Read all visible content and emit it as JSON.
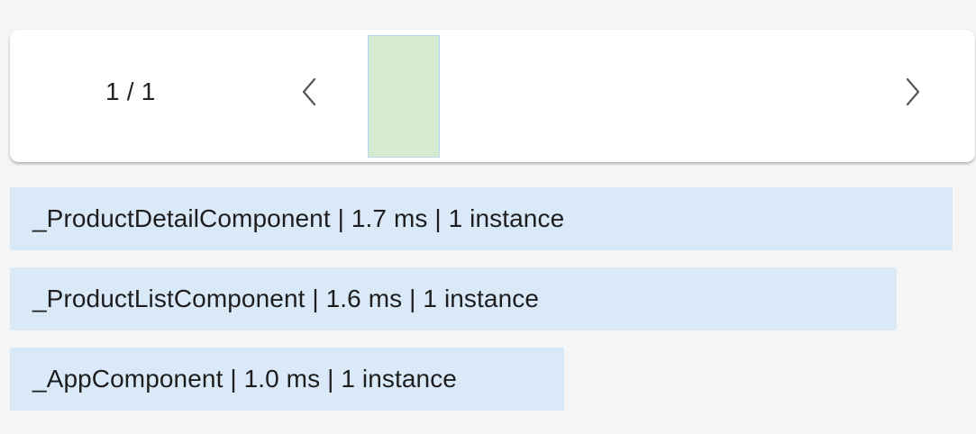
{
  "frame_navigator": {
    "page_counter": "1 / 1",
    "prev_icon": "chevron-left-icon",
    "next_icon": "chevron-right-icon",
    "selected_frame_fill": "#d5ecd1",
    "selected_frame_border": "#b9d9f2",
    "frames": [
      {
        "selected": true
      }
    ]
  },
  "components": [
    {
      "label": "_ProductDetailComponent | 1.7 ms | 1 instance",
      "name": "_ProductDetailComponent",
      "duration_ms": 1.7,
      "instances": 1
    },
    {
      "label": "_ProductListComponent | 1.6 ms | 1 instance",
      "name": "_ProductListComponent",
      "duration_ms": 1.6,
      "instances": 1
    },
    {
      "label": "_AppComponent | 1.0 ms | 1 instance",
      "name": "_AppComponent",
      "duration_ms": 1.0,
      "instances": 1
    }
  ],
  "colors": {
    "page_background": "#f5f5f5",
    "card_background": "#ffffff",
    "bar_fill": "#d9e9f8"
  }
}
